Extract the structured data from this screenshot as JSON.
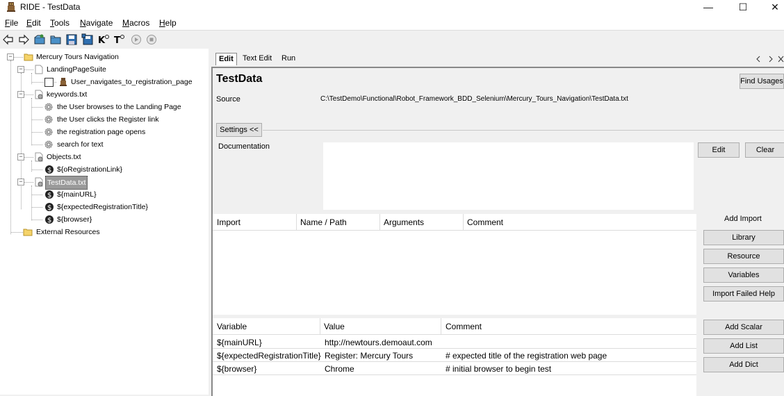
{
  "window": {
    "title": "RIDE - TestData",
    "controls": [
      "—",
      "☐",
      "✕"
    ]
  },
  "menu": [
    {
      "label": "File",
      "key": "F"
    },
    {
      "label": "Edit",
      "key": "E"
    },
    {
      "label": "Tools",
      "key": "T"
    },
    {
      "label": "Navigate",
      "key": "N"
    },
    {
      "label": "Macros",
      "key": "M"
    },
    {
      "label": "Help",
      "key": "H"
    }
  ],
  "toolbar": {
    "icons": [
      "back-icon",
      "forward-icon",
      "open-test-suite-icon",
      "open-directory-icon",
      "save-icon",
      "save-all-icon",
      "keyword-search-icon",
      "test-search-icon",
      "run-icon",
      "stop-icon"
    ]
  },
  "tree": {
    "root": "Mercury Tours Navigation",
    "suite": "LandingPageSuite",
    "test_case": "User_navigates_to_registration_page",
    "keywords_file": "keywords.txt",
    "keywords": [
      "the User browses to the Landing Page",
      "the User clicks the Register link",
      "the registration page opens",
      "search for text"
    ],
    "objects_file": "Objects.txt",
    "objects_vars": [
      "${oRegistrationLink}"
    ],
    "testdata_file": "TestData.txt",
    "testdata_vars": [
      "${mainURL}",
      "${expectedRegistrationTitle}",
      "${browser}"
    ],
    "external": "External Resources"
  },
  "tabs": [
    "Edit",
    "Text Edit",
    "Run"
  ],
  "editor": {
    "name": "TestData",
    "find_usages": "Find Usages",
    "source_label": "Source",
    "source_path": "C:\\TestDemo\\Functional\\Robot_Framework_BDD_Selenium\\Mercury_Tours_Navigation\\TestData.txt",
    "settings_toggle": "Settings <<",
    "documentation_label": "Documentation",
    "doc_edit": "Edit",
    "doc_clear": "Clear",
    "import_headers": [
      "Import",
      "Name / Path",
      "Arguments",
      "Comment"
    ],
    "add_import_label": "Add Import",
    "import_buttons": [
      "Library",
      "Resource",
      "Variables",
      "Import Failed Help"
    ],
    "var_headers": [
      "Variable",
      "Value",
      "Comment"
    ],
    "variables": [
      {
        "name": "${mainURL}",
        "value": "http://newtours.demoaut.com",
        "comment": ""
      },
      {
        "name": "${expectedRegistrationTitle}",
        "value": "Register: Mercury Tours",
        "comment": "# expected title of the registration web page"
      },
      {
        "name": "${browser}",
        "value": "Chrome",
        "comment": "# initial browser to begin test"
      }
    ],
    "var_buttons": [
      "Add Scalar",
      "Add List",
      "Add Dict"
    ]
  }
}
